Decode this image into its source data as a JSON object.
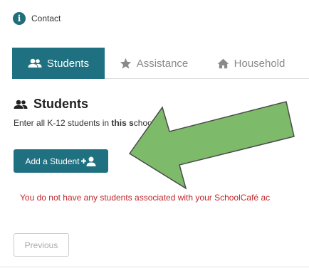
{
  "header": {
    "contact_label": "Contact",
    "icon": "info-icon"
  },
  "tabs": [
    {
      "label": "Students",
      "icon": "users-icon",
      "active": true
    },
    {
      "label": "Assistance",
      "icon": "star-icon",
      "active": false
    },
    {
      "label": "Household",
      "icon": "home-icon",
      "active": false
    }
  ],
  "section": {
    "title": "Students",
    "description_prefix": "Enter all K-12 students in ",
    "description_bold": "this s",
    "description_suffix": "chool di"
  },
  "buttons": {
    "add_student": "Add a Student",
    "previous": "Previous"
  },
  "messages": {
    "no_students": "You do not have any students associated with your SchoolCafé ac"
  },
  "colors": {
    "accent": "#1f7080",
    "error": "#c0282d",
    "arrow_fill": "#7dbb6a",
    "arrow_stroke": "#4a4a4a"
  }
}
